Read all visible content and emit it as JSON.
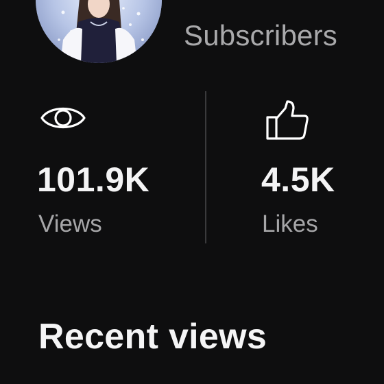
{
  "profile": {
    "subscribers_label": "Subscribers",
    "avatar_icon": "profile-avatar"
  },
  "stats": {
    "views": {
      "icon": "eye-icon",
      "value": "101.9K",
      "label": "Views"
    },
    "likes": {
      "icon": "thumbs-up-icon",
      "value": "4.5K",
      "label": "Likes"
    }
  },
  "recent": {
    "title": "Recent views"
  }
}
